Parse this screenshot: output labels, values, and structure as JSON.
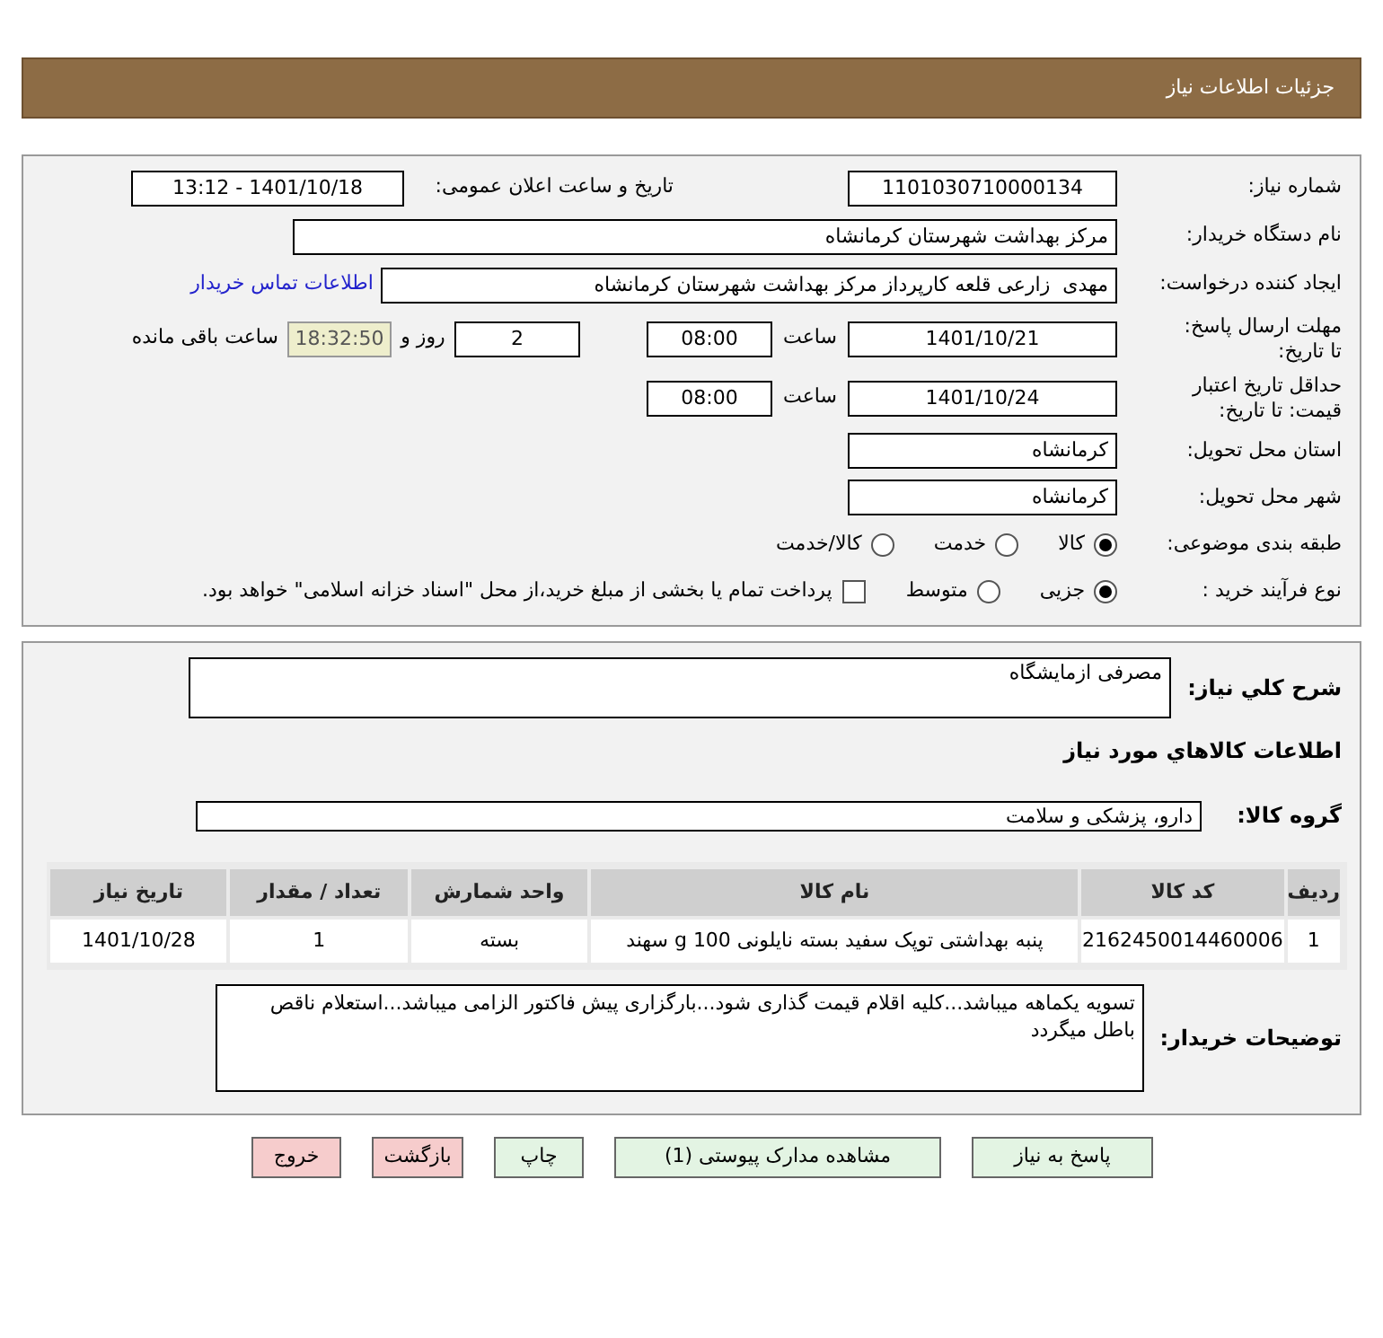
{
  "page_title": "جزئیات اطلاعات نیاز",
  "need_number": {
    "label": "شماره نیاز:",
    "value": "1101030710000134"
  },
  "announce": {
    "label": "تاریخ و ساعت اعلان عمومی:",
    "value": "1401/10/18 - 13:12"
  },
  "buyer_org": {
    "label": "نام دستگاه خریدار:",
    "value": "مرکز بهداشت شهرستان کرمانشاه"
  },
  "requester": {
    "label": "ایجاد کننده درخواست:",
    "value": "مهدی  زارعی قلعه کارپرداز مرکز بهداشت شهرستان کرمانشاه",
    "link": "اطلاعات تماس خریدار"
  },
  "reply_deadline": {
    "label": "مهلت ارسال پاسخ: تا تاریخ:",
    "date": "1401/10/21",
    "time_label": "ساعت",
    "time": "08:00",
    "days": "2",
    "days_label": "روز و",
    "remaining": "18:32:50",
    "remaining_label": "ساعت باقی مانده"
  },
  "price_validity": {
    "label": "حداقل تاریخ اعتبار قیمت: تا تاریخ:",
    "date": "1401/10/24",
    "time_label": "ساعت",
    "time": "08:00"
  },
  "province": {
    "label": "استان محل تحویل:",
    "value": "کرمانشاه"
  },
  "city": {
    "label": "شهر محل تحویل:",
    "value": "کرمانشاه"
  },
  "category": {
    "label": "طبقه بندی موضوعی:",
    "options": [
      {
        "label": "کالا",
        "selected": true
      },
      {
        "label": "خدمت",
        "selected": false
      },
      {
        "label": "کالا/خدمت",
        "selected": false
      }
    ]
  },
  "purchase_type": {
    "label": "نوع فرآیند خرید :",
    "options": [
      {
        "label": "جزیی",
        "selected": true
      },
      {
        "label": "متوسط",
        "selected": false
      }
    ],
    "treasury": {
      "label": "پرداخت تمام یا بخشی از مبلغ خرید،از محل \"اسناد خزانه اسلامی\" خواهد بود.",
      "checked": false
    }
  },
  "summary": {
    "label": "شرح کلي نياز:",
    "value": "مصرفی ازمایشگاه"
  },
  "goods_heading": "اطلاعات كالاهاي مورد نياز",
  "goods_group": {
    "label": "گروه کالا:",
    "value": "دارو، پزشکی و سلامت"
  },
  "table": {
    "columns": [
      "ردیف",
      "کد کالا",
      "نام کالا",
      "واحد شمارش",
      "تعداد / مقدار",
      "تاریخ نیاز"
    ],
    "rows": [
      [
        "1",
        "2162450014460006",
        "پنبه بهداشتی توپک سفید بسته نایلونی 100 g سهند",
        "بسته",
        "1",
        "1401/10/28"
      ]
    ]
  },
  "buyer_notes": {
    "label": "توضیحات خریدار:",
    "value": "تسویه یکماهه میباشد...کلیه اقلام قیمت گذاری شود...بارگزاری پیش فاکتور الزامی میباشد...استعلام ناقص باطل میگردد"
  },
  "buttons": [
    {
      "label": "پاسخ به نیاز",
      "kind": "normal"
    },
    {
      "label": "مشاهده مدارک پیوستی (1)",
      "kind": "normal"
    },
    {
      "label": "چاپ",
      "kind": "normal"
    },
    {
      "label": "بازگشت",
      "kind": "exit"
    },
    {
      "label": "خروج",
      "kind": "exit"
    }
  ]
}
